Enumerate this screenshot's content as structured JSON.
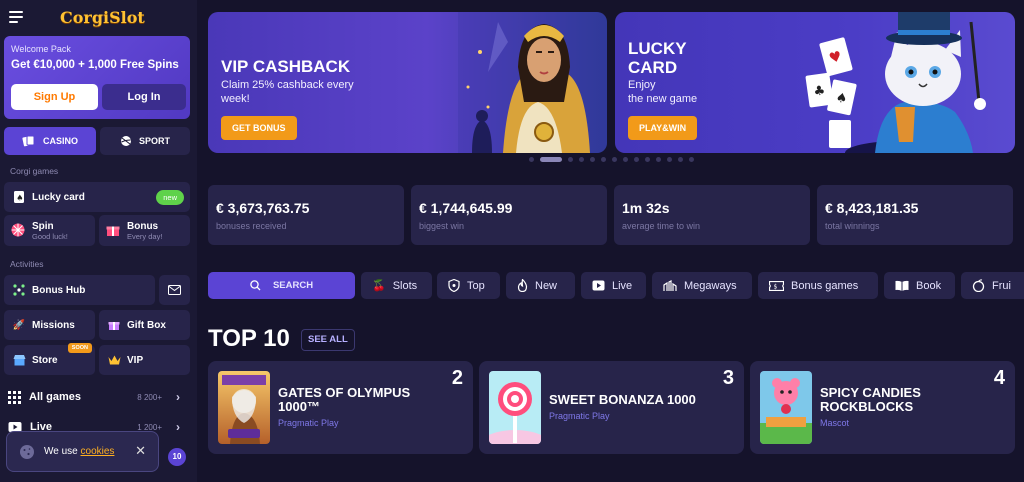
{
  "brand": {
    "name": "CorgiSlot"
  },
  "welcome": {
    "title": "Welcome Pack",
    "offer": "Get €10,000 + 1,000 Free Spins",
    "signup": "Sign Up",
    "login": "Log In"
  },
  "segments": {
    "casino": "CASINO",
    "sport": "SPORT"
  },
  "sidebar": {
    "corgi_games_title": "Corgi games",
    "lucky_card": {
      "label": "Lucky card",
      "badge": "new"
    },
    "spin": {
      "label": "Spin",
      "sub": "Good luck!"
    },
    "bonus": {
      "label": "Bonus",
      "sub": "Every day!"
    },
    "activities_title": "Activities",
    "bonus_hub": "Bonus Hub",
    "missions": "Missions",
    "gift_box": "Gift Box",
    "store": {
      "label": "Store",
      "badge": "SOON"
    },
    "vip": "VIP",
    "all_games": {
      "label": "All games",
      "count": "8 200+"
    },
    "live": {
      "label": "Live",
      "count": "1 200+"
    },
    "notif_count": "10"
  },
  "cookie": {
    "text": "We use",
    "link": "cookies"
  },
  "banners": [
    {
      "title_l1": "VIP CASHBACK",
      "desc": "Claim 25% cashback every week!",
      "button": "GET BONUS"
    },
    {
      "title_l1": "LUCKY",
      "title_l2": "CARD",
      "desc_l1": "Enjoy",
      "desc_l2": "the new game",
      "button": "PLAY&WIN"
    }
  ],
  "stats": [
    {
      "value": "€ 3,673,763.75",
      "label": "bonuses received"
    },
    {
      "value": "€ 1,744,645.99",
      "label": "biggest win"
    },
    {
      "value": "1m 32s",
      "label": "average time to win"
    },
    {
      "value": "€ 8,423,181.35",
      "label": "total winnings"
    }
  ],
  "categories": [
    "SEARCH",
    "Slots",
    "Top",
    "New",
    "Live",
    "Megaways",
    "Bonus games",
    "Book",
    "Frui"
  ],
  "top10": {
    "title": "TOP 10",
    "see_all": "SEE ALL"
  },
  "games": [
    {
      "rank": "2",
      "name": "GATES OF OLYMPUS 1000™",
      "provider": "Pragmatic Play"
    },
    {
      "rank": "3",
      "name": "SWEET BONANZA 1000",
      "provider": "Pragmatic Play"
    },
    {
      "rank": "4",
      "name": "SPICY CANDIES ROCKBLOCKS",
      "provider": "Mascot"
    }
  ],
  "colors": {
    "accent": "#5b44d4",
    "orange": "#f29a19",
    "bg": "#15132b",
    "panel": "#27244a"
  }
}
